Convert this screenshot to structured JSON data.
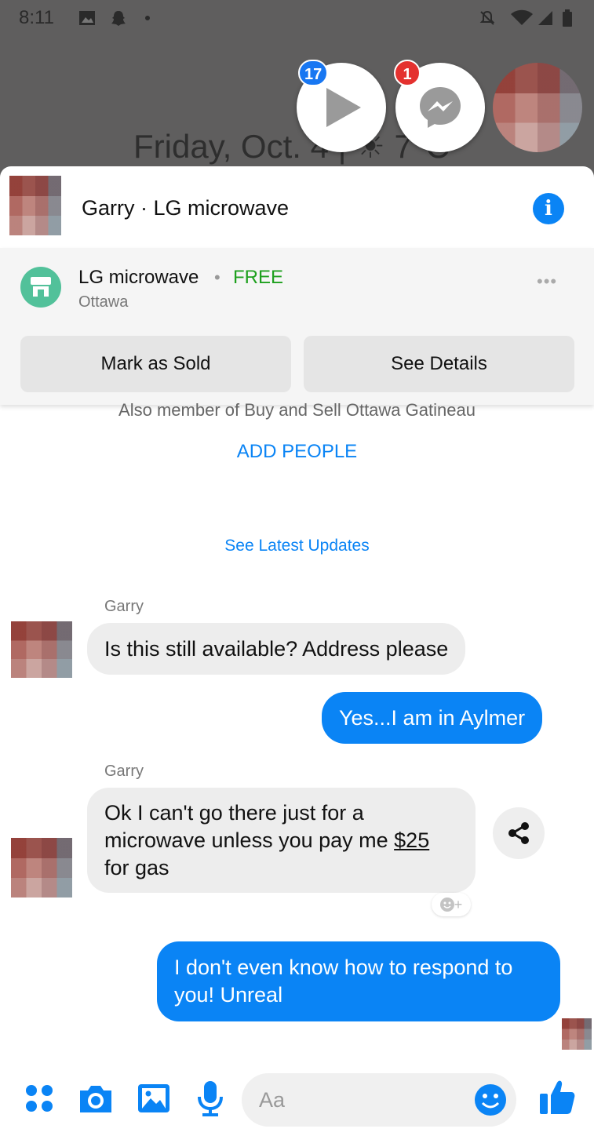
{
  "status_bar": {
    "time": "8:11"
  },
  "lockscreen": {
    "date_text": "Friday, Oct. 4 | ☀ 7°C"
  },
  "chat_heads": [
    {
      "name": "video-chat-head",
      "badge": "17",
      "badge_color": "#1877f2"
    },
    {
      "name": "messenger-chat-head",
      "badge": "1",
      "badge_color": "#e4312f"
    }
  ],
  "header": {
    "title": "Garry · LG microwave"
  },
  "listing": {
    "title": "LG microwave",
    "separator": "•",
    "price": "FREE",
    "location": "Ottawa",
    "more": "•••",
    "mark_sold_label": "Mark as Sold",
    "see_details_label": "See Details"
  },
  "group_info": {
    "member_text": "Also member of Buy and Sell Ottawa Gatineau",
    "add_people_label": "ADD PEOPLE",
    "latest_updates_label": "See Latest Updates"
  },
  "messages": [
    {
      "sender": "Garry",
      "direction": "in",
      "text": "Is this still available? Address please"
    },
    {
      "direction": "out",
      "text": "Yes...I am in Aylmer"
    },
    {
      "sender": "Garry",
      "direction": "in",
      "line1": "Ok I can't go there just for a",
      "line2_pre": "microwave unless you pay me ",
      "line2_link": "$25",
      "line3": "for gas",
      "reaction_hint": "+"
    },
    {
      "direction": "out",
      "line1": "I don't even know how to respond to",
      "line2": "you! Unreal"
    }
  ],
  "composer": {
    "placeholder": "Aa"
  },
  "colors": {
    "accent": "#0a84f5",
    "price_green": "#1ea01e",
    "bubble_in": "#ededed",
    "listing_icon": "#52c19a"
  }
}
